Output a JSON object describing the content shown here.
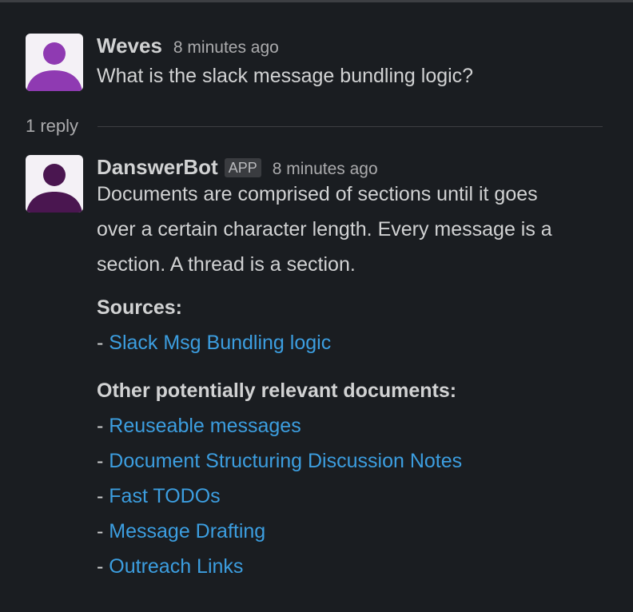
{
  "thread": {
    "parent": {
      "author": "Weves",
      "timestamp": "8 minutes ago",
      "text": "What is the slack message bundling logic?",
      "avatar_color": "#8f3ab2"
    },
    "reply_count": "1 reply",
    "reply": {
      "author": "DanswerBot",
      "badge": "APP",
      "timestamp": "8 minutes ago",
      "text": "Documents are comprised of sections until it goes over a certain character length. Every message is a section. A thread is a section.",
      "avatar_color": "#4a1650",
      "sources_heading": "Sources:",
      "sources": [
        "Slack Msg Bundling logic"
      ],
      "other_heading": "Other potentially relevant documents:",
      "other_docs": [
        "Reuseable messages",
        "Document Structuring Discussion Notes",
        "Fast TODOs",
        "Message Drafting",
        "Outreach Links"
      ],
      "bullet": "- "
    }
  },
  "colors": {
    "background": "#1a1d21",
    "text": "#d1d2d3",
    "muted": "#ababad",
    "link": "#3c9ee0"
  }
}
